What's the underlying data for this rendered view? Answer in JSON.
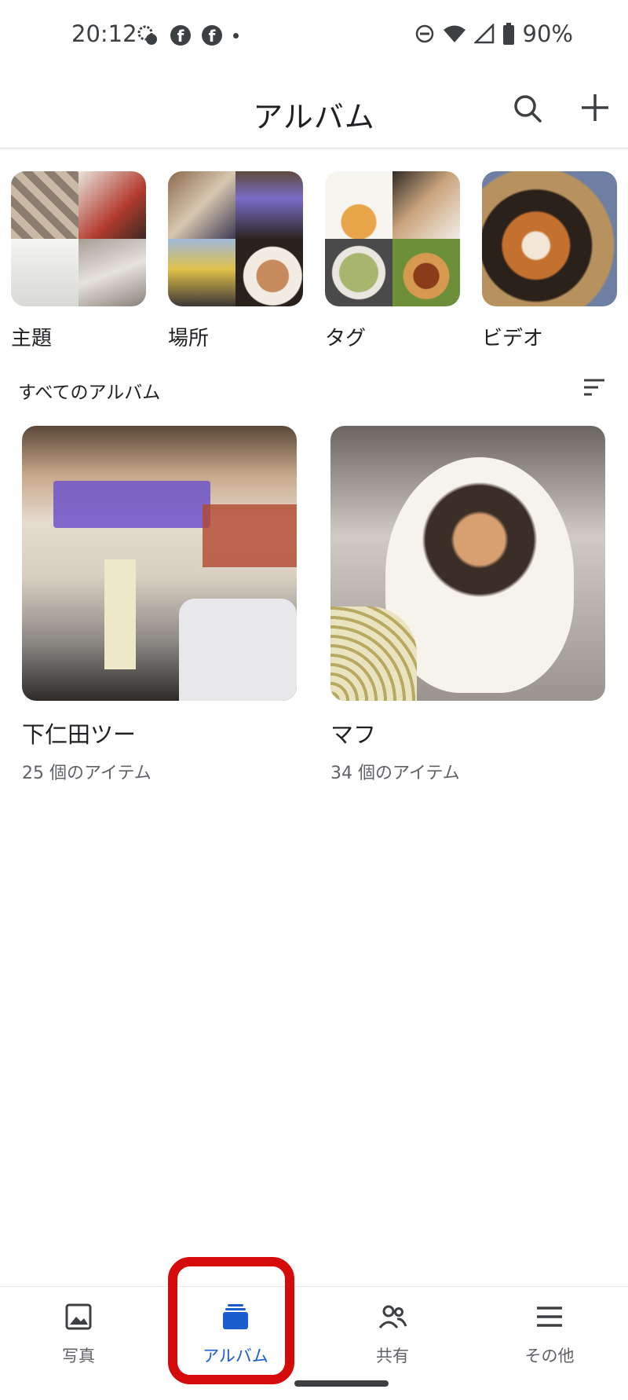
{
  "status_bar": {
    "time": "20:12",
    "battery": "90%"
  },
  "header": {
    "title": "アルバム",
    "search_icon": "search-icon",
    "add_icon": "plus-icon"
  },
  "categories": [
    {
      "label": "主題"
    },
    {
      "label": "場所"
    },
    {
      "label": "タグ"
    },
    {
      "label": "ビデオ"
    }
  ],
  "section": {
    "title": "すべてのアルバム",
    "sort_icon": "sort-icon"
  },
  "albums": [
    {
      "name": "下仁田ツー",
      "count": "25 個のアイテム"
    },
    {
      "name": "マフ",
      "count": "34 個のアイテム"
    }
  ],
  "nav": [
    {
      "label": "写真",
      "icon": "photo-icon"
    },
    {
      "label": "アルバム",
      "icon": "albums-icon",
      "active": true
    },
    {
      "label": "共有",
      "icon": "people-icon"
    },
    {
      "label": "その他",
      "icon": "menu-icon"
    }
  ],
  "colors": {
    "accent": "#1a5dcc",
    "highlight": "#d50b0b"
  }
}
